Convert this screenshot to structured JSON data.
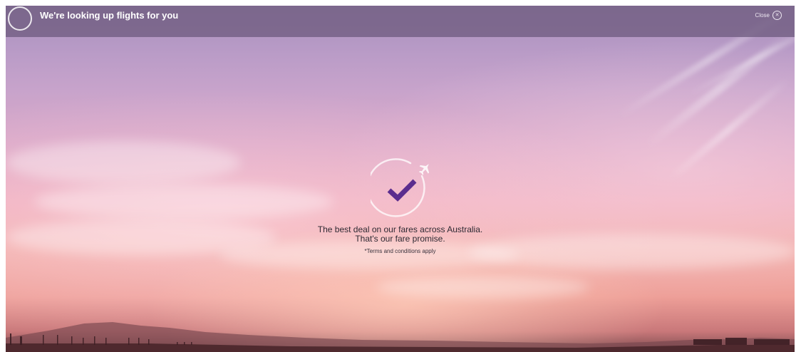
{
  "header": {
    "title": "We're looking up flights for you",
    "close_label": "Close",
    "close_icon": "close-icon"
  },
  "status": {
    "icon": "checkmark-plane-icon",
    "check_color": "#5b2d8e"
  },
  "promo": {
    "line1": "The best deal on our fares across Australia.",
    "line2": "That's our fare promise.",
    "terms": "*Terms and conditions apply"
  },
  "colors": {
    "header_bg": "#705c80",
    "accent_purple": "#5b2d8e"
  }
}
